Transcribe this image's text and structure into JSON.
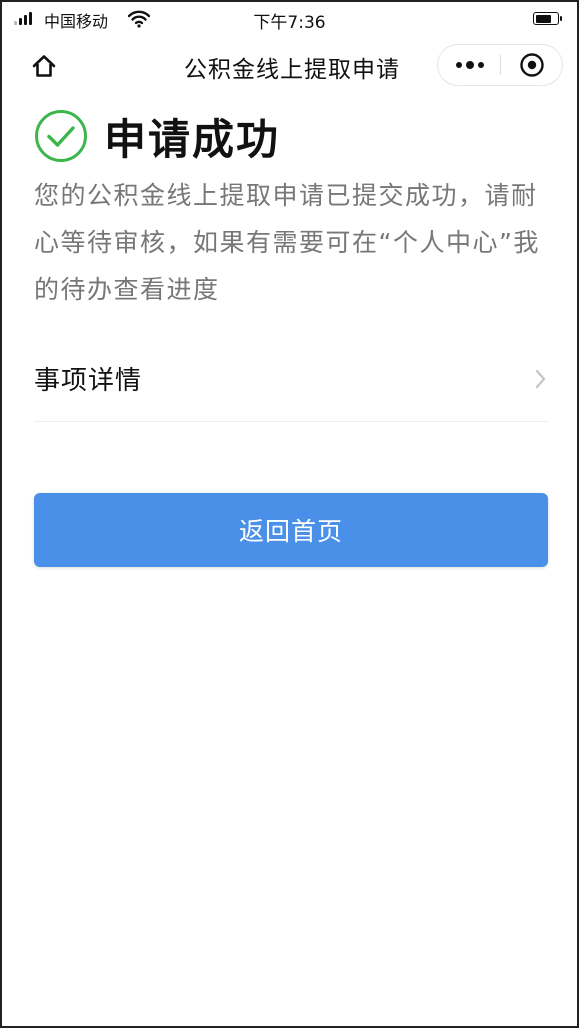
{
  "status_bar": {
    "carrier": "中国移动",
    "time": "下午7:36",
    "battery_level": 0.75
  },
  "nav": {
    "title": "公积金线上提取申请",
    "home_icon": "home-icon",
    "more_icon": "more-dots-icon",
    "close_icon": "target-close-icon"
  },
  "result": {
    "icon": "check-circle-icon",
    "title": "申请成功",
    "description": "您的公积金线上提取申请已提交成功，请耐心等待审核，如果有需要可在“个人中心”我的待办查看进度",
    "colors": {
      "success": "#3cb64a"
    }
  },
  "detail": {
    "label": "事项详情",
    "icon": "chevron-right-icon"
  },
  "actions": {
    "back_home_label": "返回首页",
    "button_color": "#4a90e8"
  }
}
